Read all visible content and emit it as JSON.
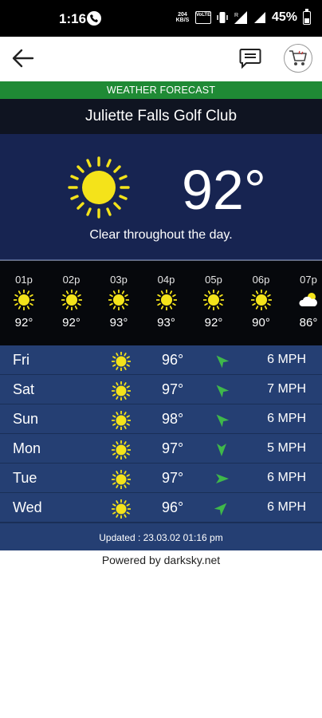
{
  "status_bar": {
    "time": "1:16",
    "mini_top": "204",
    "mini_bottom": "KB/S",
    "volte_label": "VoLTE",
    "battery": "45%"
  },
  "app_bar": {
    "back_icon": "arrow-left",
    "chat_icon": "chat-bubble",
    "cart_icon": "shopping-cart"
  },
  "header": {
    "section_label": "WEATHER FORECAST",
    "club_name": "Juliette Falls Golf Club"
  },
  "current": {
    "icon": "sun",
    "temperature": "92°",
    "summary": "Clear throughout the day."
  },
  "hourly": [
    {
      "time": "01p",
      "icon": "sun",
      "temp": "92°"
    },
    {
      "time": "02p",
      "icon": "sun",
      "temp": "92°"
    },
    {
      "time": "03p",
      "icon": "sun",
      "temp": "93°"
    },
    {
      "time": "04p",
      "icon": "sun",
      "temp": "93°"
    },
    {
      "time": "05p",
      "icon": "sun",
      "temp": "92°"
    },
    {
      "time": "06p",
      "icon": "sun",
      "temp": "90°"
    },
    {
      "time": "07p",
      "icon": "cloud",
      "temp": "86°"
    }
  ],
  "daily": [
    {
      "day": "Fri",
      "icon": "sun",
      "temp": "96°",
      "wind_dir_deg": 315,
      "wind": "6 MPH"
    },
    {
      "day": "Sat",
      "icon": "sun",
      "temp": "97°",
      "wind_dir_deg": 315,
      "wind": "7 MPH"
    },
    {
      "day": "Sun",
      "icon": "sun",
      "temp": "98°",
      "wind_dir_deg": 315,
      "wind": "6 MPH"
    },
    {
      "day": "Mon",
      "icon": "sun",
      "temp": "97°",
      "wind_dir_deg": 180,
      "wind": "5 MPH"
    },
    {
      "day": "Tue",
      "icon": "sun",
      "temp": "97°",
      "wind_dir_deg": 90,
      "wind": "6 MPH"
    },
    {
      "day": "Wed",
      "icon": "sun",
      "temp": "96°",
      "wind_dir_deg": 45,
      "wind": "6 MPH"
    }
  ],
  "updated": "Updated : 23.03.02 01:16 pm",
  "powered_by": "Powered by darksky.net",
  "colors": {
    "forecast_green": "#1f8a35",
    "club_band": "#0f1421",
    "current_bg": "#172451",
    "hourly_bg": "#06080c",
    "daily_bg": "#253f73",
    "sun_yellow": "#f4e31a",
    "wind_arrow_green": "#3fb84a"
  }
}
